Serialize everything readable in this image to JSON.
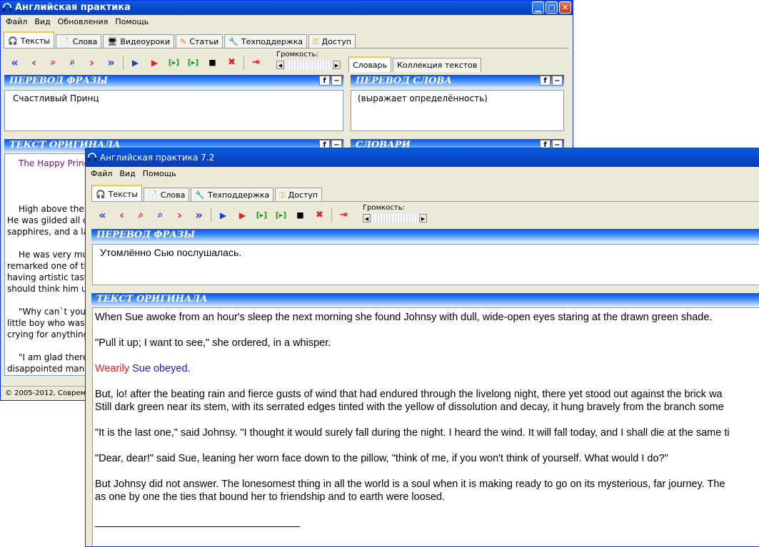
{
  "back_window": {
    "title": "Английская практика",
    "menu": [
      "Файл",
      "Вид",
      "Обновления",
      "Помощь"
    ],
    "tabs": [
      "Тексты",
      "Слова",
      "Видеоуроки",
      "Статьи",
      "Техподдержка",
      "Доступ"
    ],
    "volume_label": "Громкость:",
    "right_tabs": [
      "Словарь",
      "Коллекция текстов"
    ],
    "phrase_panel": {
      "title": "ПЕРЕВОД ФРАЗЫ",
      "text": "Счастливый Принц"
    },
    "word_panel": {
      "title": "ПЕРЕВОД СЛОВА",
      "text": "(выражает определённость)"
    },
    "original_panel": {
      "title": "ТЕКСТ ОРИГИНАЛА",
      "line_title": "The Happy Princ",
      "lines": [
        "High above the c",
        "He was gilded all o",
        "sapphires, and a la",
        "He was very mu",
        "remarked one of th",
        "having artistic taste",
        "should think him u",
        "\"Why can`t you",
        "little boy who was c",
        "crying for anything.",
        "\"I am glad there",
        "disappointed man a"
      ]
    },
    "dict_panel_title": "СЛОВАРИ",
    "status": "© 2005-2012, Совреме"
  },
  "front_window": {
    "title": "Английская практика 7.2",
    "menu": [
      "Файл",
      "Вид",
      "Помощь"
    ],
    "tabs": [
      "Тексты",
      "Слова",
      "Техподдержка",
      "Доступ"
    ],
    "volume_label": "Громкость:",
    "phrase_panel": {
      "title": "ПЕРЕВОД ФРАЗЫ",
      "text": "Утомлённо Сью послушалась."
    },
    "original_panel": {
      "title": "ТЕКСТ ОРИГИНАЛА",
      "p1": "When Sue awoke from an hour's sleep the next morning she found Johnsy with dull, wide-open eyes staring at the drawn green shade.",
      "p2": "\"Pull it up; I want to see,\" she ordered, in a whisper.",
      "p3_red": "Wearily",
      "p3_blue": "Sue obeyed.",
      "p4a": "But, lo! after the beating rain and fierce gusts of wind that had endured through the livelong night, there yet stood out against the brick wa",
      "p4b": "Still dark green near its stem, with its serrated edges tinted with the yellow of dissolution and decay, it hung bravely from the branch some",
      "p5": "\"It is the last one,\" said Johnsy. \"I thought it would surely fall during the night. I heard the wind. It will fall today, and I shall die at the same ti",
      "p6": "\"Dear, dear!\" said Sue, leaning her worn face down to the pillow, \"think of me, if you won't think of yourself. What would I do?\"",
      "p7a": "But Johnsy did not answer. The lonesomest thing in all the world is a soul when it is making ready to go on its mysterious, far journey. The",
      "p7b": "as one by one the ties that bound her to friendship and to earth were loosed."
    }
  },
  "toolbar_icons": [
    "rewind-all",
    "prev",
    "repeat-phrase",
    "repeat-all",
    "next",
    "forward-all",
    "play-original",
    "play-translation",
    "play-segment",
    "play-segment-alt",
    "stop",
    "mute",
    "exit"
  ],
  "colors": {
    "title_blue": "#0842c6",
    "panel_blue": "#0b4fe8",
    "text_red": "#e02020",
    "text_blue": "#1a1ad0",
    "purple": "#7a1070"
  }
}
